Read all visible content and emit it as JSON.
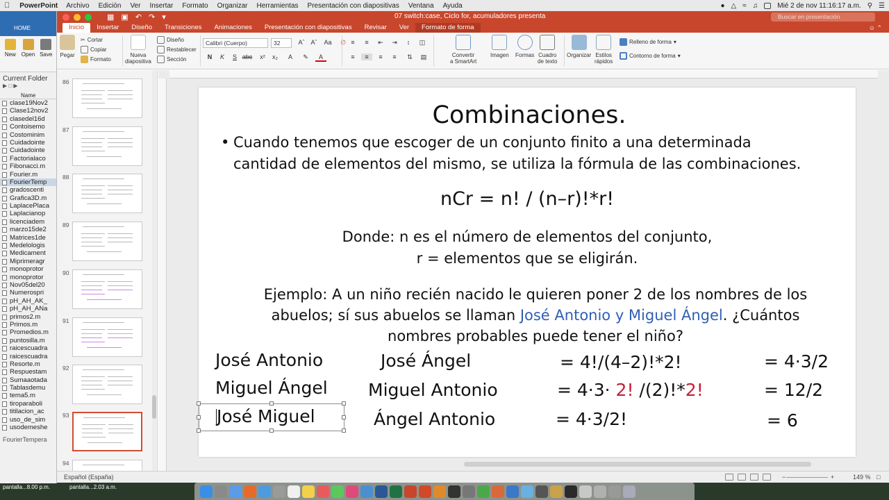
{
  "menubar": {
    "app": "PowerPoint",
    "items": [
      "Archivo",
      "Edición",
      "Ver",
      "Insertar",
      "Formato",
      "Organizar",
      "Herramientas",
      "Presentación con diapositivas",
      "Ventana",
      "Ayuda"
    ],
    "clock": "Mié 2 de nov  11:16:17 a.m."
  },
  "matlab": {
    "tab": "HOME",
    "tools": [
      "New",
      "Open",
      "Save"
    ],
    "panel_title": "Current Folder",
    "column": "Name",
    "files": [
      "clase19Nov2",
      "Clase12nov2",
      "clasedel16d",
      "Contoisemo",
      "Costominim",
      "Cuidadointe",
      "Cuidadointe",
      "Factorialaco",
      "Fibonacci.m",
      "Fourier.m",
      "FourierTemp",
      "gradoscenti",
      "Grafica3D.m",
      "LaplacePlaca",
      "Laplacianop",
      "licenciadem",
      "marzo15de2",
      "Matrices1de",
      "Medelologis",
      "Medicament",
      "Miprimeragr",
      "monoprotor",
      "monoprotor",
      "Nov05del20",
      "Numerospri",
      "pH_AH_AK_",
      "pH_AH_ANa",
      "primos2.m",
      "Primos.m",
      "Promedios.m",
      "puntosilla.m",
      "raicescuadra",
      "raicescuadra",
      "Resorte.m",
      "Respuestam",
      "Sumaaotada",
      "Tablasdemu",
      "tema5.m",
      "tiroparaboli",
      "titilacion_ac",
      "uso_de_sim",
      "usodemeshe"
    ],
    "footer": "FourierTempera"
  },
  "ppt": {
    "doc_title": "07 switch:case, Ciclo for, acumuladores presenta",
    "search_placeholder": "Buscar en presentación",
    "tabs": [
      "Inicio",
      "Insertar",
      "Diseño",
      "Transiciones",
      "Animaciones",
      "Presentación con diapositivas",
      "Revisar",
      "Ver",
      "Formato de forma"
    ],
    "ribbon": {
      "pegar": "Pegar",
      "cortar": "Cortar",
      "copiar": "Copiar",
      "formato": "Formato",
      "nueva": "Nueva",
      "diapositiva": "diapositiva",
      "diseno": "Diseño",
      "restablecer": "Restablecer",
      "seccion": "Sección",
      "font": "Calibri (Cuerpo)",
      "size": "32",
      "convertir": "Convertir",
      "smartart": "a SmartArt",
      "imagen": "Imagen",
      "formas": "Formas",
      "cuadro": "Cuadro",
      "detexto": "de texto",
      "organizar": "Organizar",
      "estilos": "Estilos",
      "rapidos": "rápidos",
      "relleno": "Relleno de forma",
      "contorno": "Contorno de forma"
    },
    "thumbnails": [
      {
        "num": "86",
        "selected": false
      },
      {
        "num": "87",
        "selected": false
      },
      {
        "num": "88",
        "selected": false
      },
      {
        "num": "89",
        "selected": false
      },
      {
        "num": "90",
        "selected": false
      },
      {
        "num": "91",
        "selected": false
      },
      {
        "num": "92",
        "selected": false
      },
      {
        "num": "93",
        "selected": true
      },
      {
        "num": "94",
        "selected": false
      }
    ],
    "status": {
      "language": "Español (España)",
      "zoom": "149 %"
    }
  },
  "slide": {
    "title": "Combinaciones.",
    "bullet_1": "Cuando tenemos que escoger de un conjunto finito a una determinada",
    "bullet_2": "cantidad de elementos del mismo, se utiliza la fórmula de las combinaciones.",
    "formula": "nCr = n! / (n–r)!*r!",
    "donde_1": "Donde: n es el número de elementos del conjunto,",
    "donde_2": "r = elementos que se eligirán.",
    "ej_1": "Ejemplo: A un niño recién nacido le quieren poner 2 de los nombres de los",
    "ej_2a": "abuelos; sí sus abuelos se llaman ",
    "ej_2b": "José Antonio y Miguel Ángel",
    "ej_2c": ". ¿Cuántos",
    "ej_3": "nombres probables puede tener el niño?",
    "col1": [
      "José Antonio",
      "Miguel Ángel",
      "José Miguel"
    ],
    "col2": [
      "José Ángel",
      "Miguel Antonio",
      "Ángel Antonio"
    ],
    "col3_r1": "= 4!/(4–2)!*2!",
    "col3_r2a": "= 4·3· ",
    "col3_r2b": "2!",
    "col3_r2c": " /(2)!*",
    "col3_r2d": "2!",
    "col3_r3": "= 4·3/2!",
    "col4": [
      "= 4·3/2",
      "= 12/2",
      "= 6"
    ]
  },
  "desktop": {
    "label1": "pantalla...8.00 p.m.",
    "label2": "pantalla...2.03 a.m."
  }
}
